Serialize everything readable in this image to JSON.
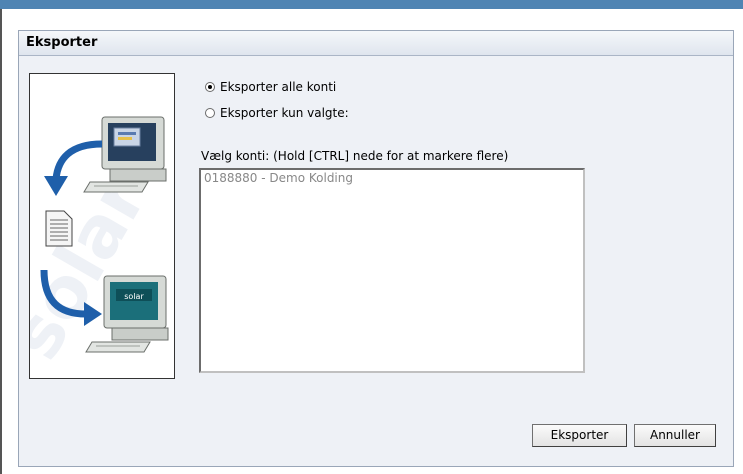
{
  "dialog": {
    "title": "Eksporter",
    "options": [
      {
        "label": "Eksporter alle konti",
        "checked": true
      },
      {
        "label": "Eksporter kun valgte:",
        "checked": false
      }
    ],
    "konti_label": "Vælg konti: (Hold [CTRL] nede for at markere flere)",
    "konti_list": [
      "0188880 - Demo Kolding"
    ],
    "buttons": {
      "export": "Eksporter",
      "cancel": "Annuller"
    },
    "illustration": {
      "watermark_text": "solar",
      "screen_text": "solar"
    }
  },
  "colors": {
    "top_bar": "#4f84b3",
    "dialog_bg": "#eef1f6",
    "arrow_blue": "#1f5faa",
    "screen_teal": "#1b6f7a"
  }
}
